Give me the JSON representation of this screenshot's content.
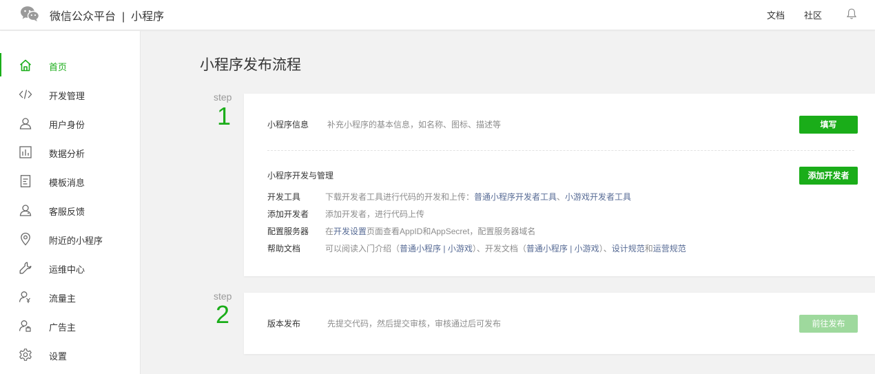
{
  "header": {
    "brand_left": "微信公众平台",
    "separator": "|",
    "brand_right": "小程序",
    "link_docs": "文档",
    "link_community": "社区"
  },
  "sidebar": {
    "items": [
      {
        "label": "首页",
        "icon": "home-icon",
        "active": true
      },
      {
        "label": "开发管理",
        "icon": "code-icon"
      },
      {
        "label": "用户身份",
        "icon": "user-icon"
      },
      {
        "label": "数据分析",
        "icon": "bar-chart-icon"
      },
      {
        "label": "模板消息",
        "icon": "document-icon"
      },
      {
        "label": "客服反馈",
        "icon": "service-icon"
      },
      {
        "label": "附近的小程序",
        "icon": "location-pin-icon"
      },
      {
        "label": "运维中心",
        "icon": "wrench-icon"
      },
      {
        "label": "流量主",
        "icon": "traffic-owner-icon"
      },
      {
        "label": "广告主",
        "icon": "advertiser-icon"
      },
      {
        "label": "设置",
        "icon": "gear-icon"
      }
    ]
  },
  "main": {
    "title": "小程序发布流程",
    "step_word": "step",
    "step1": {
      "number": "1",
      "info_label": "小程序信息",
      "info_desc": "补充小程序的基本信息，如名称、图标、描述等",
      "fill_button": "填写",
      "dev_title": "小程序开发与管理",
      "add_dev_button": "添加开发者",
      "tools": {
        "label": "开发工具",
        "desc_prefix": "下载开发者工具进行代码的开发和上传：",
        "link1": "普通小程序开发者工具",
        "sep": "、",
        "link2": "小游戏开发者工具"
      },
      "add_dev": {
        "label": "添加开发者",
        "desc": "添加开发者，进行代码上传"
      },
      "server": {
        "label": "配置服务器",
        "desc_prefix": "在",
        "link": "开发设置",
        "desc_suffix": "页面查看AppID和AppSecret，配置服务器域名"
      },
      "help": {
        "label": "帮助文档",
        "t1": "可以阅读入门介绍（",
        "l1": "普通小程序",
        "p1": " | ",
        "l2": "小游戏",
        "t2": "）、开发文档（",
        "l3": "普通小程序",
        "p2": " | ",
        "l4": "小游戏",
        "t3": "）、",
        "l5": "设计规范",
        "t4": "和",
        "l6": "运营规范"
      }
    },
    "step2": {
      "number": "2",
      "label": "版本发布",
      "desc": "先提交代码，然后提交审核，审核通过后可发布",
      "publish_button": "前往发布"
    }
  },
  "colors": {
    "accent": "#1aad19",
    "accent_disabled": "#9ed99d",
    "link": "#576b95"
  }
}
